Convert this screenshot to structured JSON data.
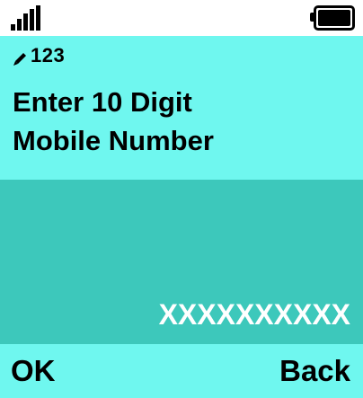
{
  "status_bar": {
    "signal_icon": "signal-strength-icon",
    "battery_icon": "battery-full-icon",
    "signal_level": 1.0,
    "battery_level": 1.0
  },
  "header": {
    "input_mode_icon": "pencil-icon",
    "input_mode": "123",
    "title_line1": "Enter 10 Digit",
    "title_line2": "Mobile Number"
  },
  "input": {
    "value": "XXXXXXXXXX"
  },
  "softkeys": {
    "left": "OK",
    "right": "Back"
  },
  "colors": {
    "header_background": "#6ff7ef",
    "input_background": "#3dc8bb",
    "input_text": "#ffffff"
  }
}
